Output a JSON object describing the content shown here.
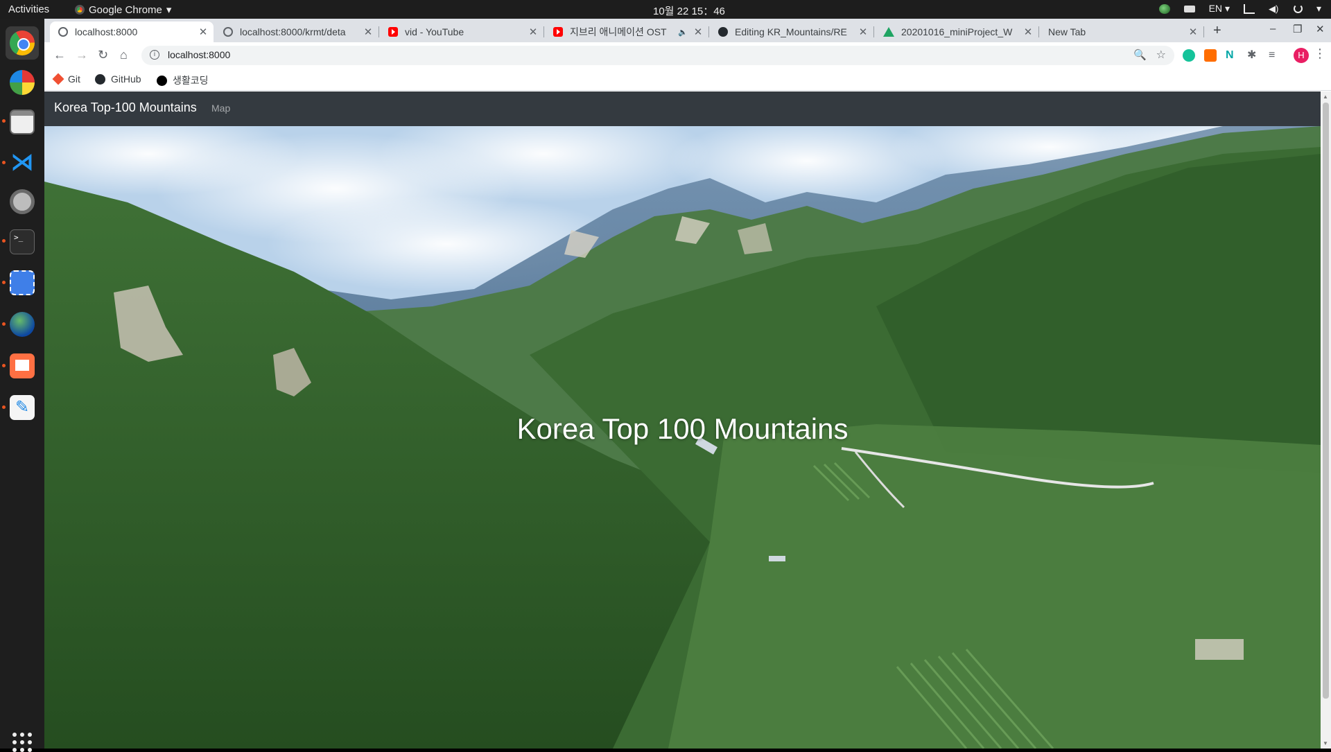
{
  "topbar": {
    "activities": "Activities",
    "app_menu": "Google Chrome",
    "app_menu_arrow": "▾",
    "clock": "10월 22  15：46",
    "language": "EN",
    "language_arrow": "▾",
    "system_arrow": "▾"
  },
  "dock": {
    "apps": [
      "chrome-icon",
      "photos-icon",
      "files-icon",
      "vscode-icon",
      "settings-icon",
      "terminal-icon",
      "screenshot-icon",
      "globe-icon",
      "presentation-icon",
      "text-editor-icon"
    ],
    "vscode_glyph": "⋊",
    "terminal_glyph": ">_",
    "editor_glyph": "✎"
  },
  "browser": {
    "tabs": [
      {
        "label": "localhost:8000",
        "icon": "globe-icon",
        "active": true
      },
      {
        "label": "localhost:8000/krmt/deta",
        "icon": "globe-icon",
        "active": false
      },
      {
        "label": "vid - YouTube",
        "icon": "youtube-icon",
        "active": false
      },
      {
        "label": "지브리 애니메이션 OST",
        "icon": "youtube-icon",
        "active": false,
        "audio": "🔈"
      },
      {
        "label": "Editing KR_Mountains/RE",
        "icon": "github-icon",
        "active": false
      },
      {
        "label": "20201016_miniProject_W",
        "icon": "drive-icon",
        "active": false
      },
      {
        "label": "New Tab",
        "icon": "",
        "active": false
      }
    ],
    "close_glyph": "✕",
    "new_tab_glyph": "+",
    "window_controls": {
      "minimize": "–",
      "restore": "❐",
      "close": "✕"
    },
    "nav": {
      "back": "←",
      "forward": "→",
      "reload": "↻",
      "home": "⌂"
    },
    "address": {
      "info": "i",
      "url": "localhost:8000",
      "zoom": "🔍",
      "star": "☆"
    },
    "extensions": {
      "grammarly": "",
      "rx": "",
      "n_glyph": "N",
      "puzzle_glyph": "✱",
      "media_glyph": "≡"
    },
    "profile_initial": "H",
    "menu_glyph": "⋮",
    "bookmarks": [
      {
        "label": "Git",
        "icon": "git-icon"
      },
      {
        "label": "GitHub",
        "icon": "github-icon"
      },
      {
        "label": "생활코딩",
        "icon": "dot-icon"
      }
    ]
  },
  "page": {
    "brand": "Korea Top-100 Mountains",
    "nav_link": "Map",
    "hero_title": "Korea Top 100 Mountains"
  },
  "scrollbar": {
    "up": "▲",
    "down": "▼"
  },
  "colors": {
    "navbar_bg": "#343a40",
    "accent_ubuntu": "#e95420",
    "tab_strip": "#dee1e6"
  }
}
